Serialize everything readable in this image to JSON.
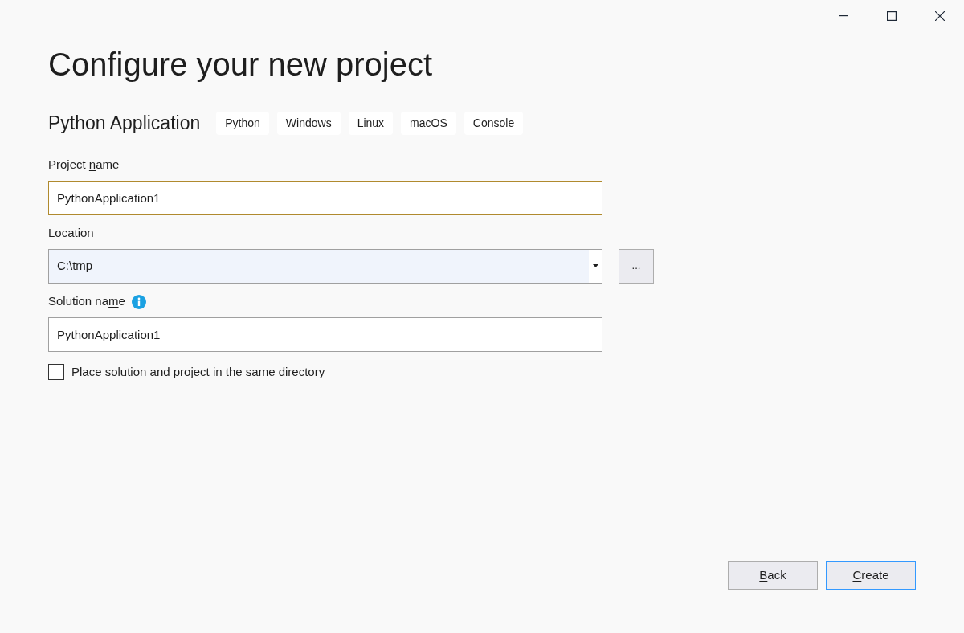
{
  "title": "Configure your new project",
  "template": {
    "name": "Python Application",
    "tags": [
      "Python",
      "Windows",
      "Linux",
      "macOS",
      "Console"
    ]
  },
  "fields": [
    {
      "kind": "text",
      "label": [
        {
          "text": "Project "
        },
        {
          "text": "n",
          "access_key": true
        },
        {
          "text": "ame"
        }
      ],
      "value": "PythonApplication1",
      "focused": true,
      "info": false
    },
    {
      "kind": "combo",
      "label": [
        {
          "text": "L",
          "access_key": true
        },
        {
          "text": "ocation"
        }
      ],
      "value": "C:\\tmp",
      "focused": false,
      "info": false,
      "browse": "..."
    },
    {
      "kind": "text",
      "label": [
        {
          "text": "Solution na"
        },
        {
          "text": "m",
          "access_key": true
        },
        {
          "text": "e"
        }
      ],
      "value": "PythonApplication1",
      "focused": false,
      "info": true
    }
  ],
  "checkbox": {
    "label": [
      {
        "text": "Place solution and project in the same "
      },
      {
        "text": "d",
        "access_key": true
      },
      {
        "text": "irectory"
      }
    ],
    "checked": false
  },
  "buttons": [
    {
      "label": [
        {
          "text": "B",
          "access_key": true
        },
        {
          "text": "ack"
        }
      ],
      "default": false
    },
    {
      "label": [
        {
          "text": "C",
          "access_key": true
        },
        {
          "text": "reate"
        }
      ],
      "default": true
    }
  ]
}
